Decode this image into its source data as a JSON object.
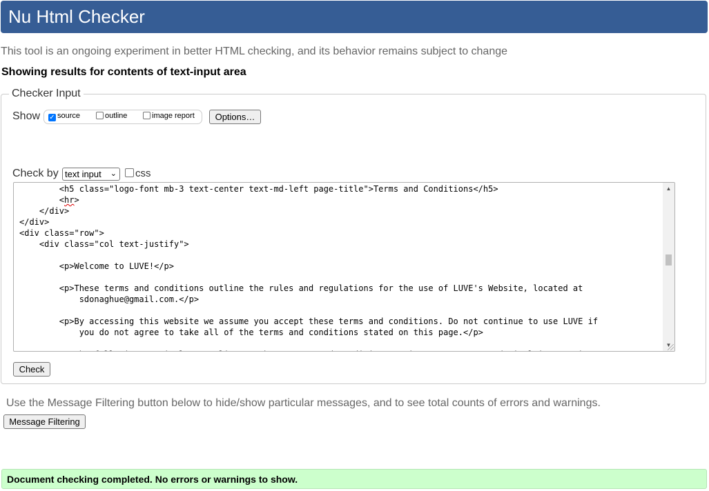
{
  "header": {
    "title": "Nu Html Checker"
  },
  "tagline": "This tool is an ongoing experiment in better HTML checking, and its behavior remains subject to change",
  "results_heading": "Showing results for contents of text-input area",
  "checker_input": {
    "legend": "Checker Input",
    "show_label": "Show",
    "show_options": [
      {
        "label": "source",
        "checked": true
      },
      {
        "label": "outline",
        "checked": false
      },
      {
        "label": "image report",
        "checked": false
      }
    ],
    "options_button": "Options…",
    "check_by_label": "Check by",
    "check_by_value": "text input",
    "css_label": "css",
    "css_checked": false,
    "check_button": "Check",
    "source_lines": [
      "        <h5 class=\"logo-font mb-3 text-center text-md-left page-title\">Terms and Conditions</h5>",
      "        <hr>",
      "    </div>",
      "</div>",
      "<div class=\"row\">",
      "    <div class=\"col text-justify\">",
      "",
      "        <p>Welcome to LUVE!</p>",
      "",
      "        <p>These terms and conditions outline the rules and regulations for the use of LUVE's Website, located at",
      "            sdonaghue@gmail.com.</p>",
      "",
      "        <p>By accessing this website we assume you accept these terms and conditions. Do not continue to use LUVE if",
      "            you do not agree to take all of the terms and conditions stated on this page.</p>",
      "",
      "        <p>The following terminology applies to these Terms and Conditions, Privacy Statement and Disclaimer Notice"
    ]
  },
  "filter_note": "Use the Message Filtering button below to hide/show particular messages, and to see total counts of errors and warnings.",
  "message_filtering_button": "Message Filtering",
  "status_message": "Document checking completed. No errors or warnings to show.",
  "colors": {
    "header_bg": "#365d95",
    "success_bg": "#ccffcc"
  }
}
